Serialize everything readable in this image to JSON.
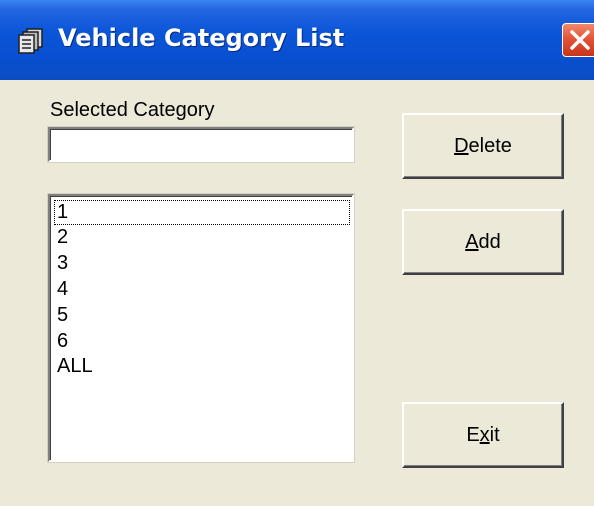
{
  "window": {
    "title": "Vehicle Category List",
    "title_icon": "app-icon",
    "close_icon": "close-icon",
    "title_color": "#0a55d8",
    "close_color": "#e2553a"
  },
  "form": {
    "selected_label": "Selected Category",
    "selected_value": "",
    "categories": [
      "1",
      "2",
      "3",
      "4",
      "5",
      "6",
      "ALL"
    ],
    "focused_index": 0
  },
  "buttons": {
    "delete": {
      "pre": "",
      "accel": "D",
      "post": "elete"
    },
    "add": {
      "pre": "",
      "accel": "A",
      "post": "dd"
    },
    "exit": {
      "pre": "E",
      "accel": "x",
      "post": "it"
    }
  }
}
